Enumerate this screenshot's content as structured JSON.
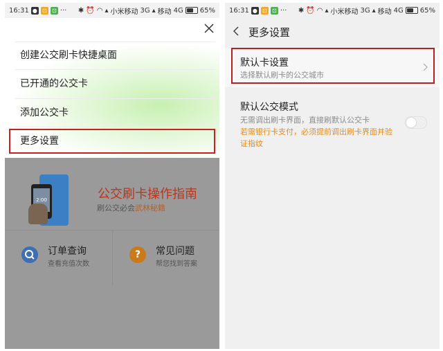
{
  "status_bar": {
    "time": "16:31",
    "carrier1": "小米移动",
    "net1": "3G",
    "carrier2": "移动",
    "net2": "4G",
    "battery": "65%",
    "battery_level": 0.65
  },
  "left": {
    "menu": [
      {
        "label": "创建公交刷卡快捷桌面"
      },
      {
        "label": "已开通的公交卡"
      },
      {
        "label": "添加公交卡"
      },
      {
        "label": "更多设置"
      }
    ],
    "guide": {
      "title": "公交刷卡操作指南",
      "subtitle_prefix": "刷公交必会",
      "subtitle_highlight": "武林秘籍",
      "phone_screen": "2:00"
    },
    "features": [
      {
        "title": "订单查询",
        "subtitle": "查看充值次数",
        "icon": "search-icon",
        "color": "#3d6fb2"
      },
      {
        "title": "常见问题",
        "subtitle": "帮您找到答案",
        "icon": "question-icon",
        "glyph": "?",
        "color": "#c97a1b"
      }
    ]
  },
  "right": {
    "title": "更多设置",
    "default_card": {
      "title": "默认卡设置",
      "subtitle": "选择默认刷卡的公交城市"
    },
    "bus_mode": {
      "title": "默认公交模式",
      "description": "无需调出刷卡界面，直接刷默认公交卡",
      "warning": "若需银行卡支付，必须提前调出刷卡界面并验证指纹",
      "enabled": false
    }
  },
  "colors": {
    "highlight_border": "#cc1f1f",
    "warning_text": "#e38c1d",
    "guide_title": "#b8361b"
  }
}
